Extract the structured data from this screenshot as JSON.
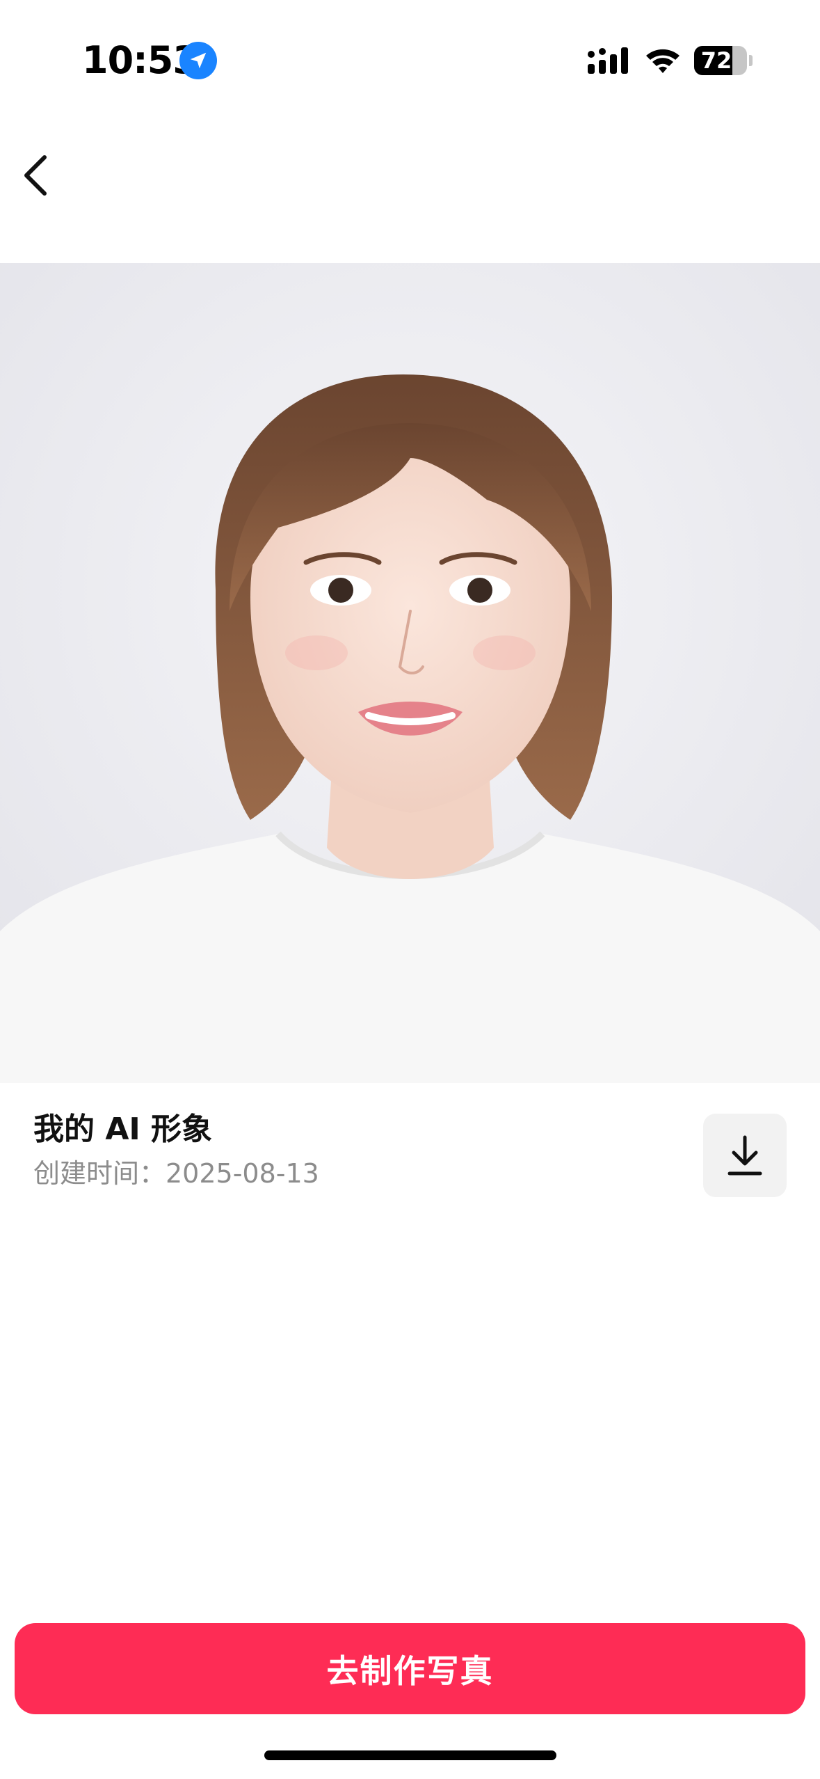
{
  "status_bar": {
    "time": "10:53",
    "battery_percent": 72,
    "battery_label": "72",
    "icons": [
      "location-arrow-icon",
      "cellular-signal-icon",
      "wifi-icon",
      "battery-icon"
    ]
  },
  "nav": {
    "back_icon": "chevron-left-icon"
  },
  "photo": {
    "description_icon": "ai-portrait-image"
  },
  "info": {
    "title": "我的 AI 形象",
    "created": "创建时间：2025-08-13",
    "download_icon": "download-icon"
  },
  "cta": {
    "label": "去制作写真"
  },
  "colors": {
    "accent": "#fe2c55",
    "location_badge": "#1a84ff",
    "download_bg": "#f2f2f2",
    "subtitle": "#8c8c8c"
  }
}
